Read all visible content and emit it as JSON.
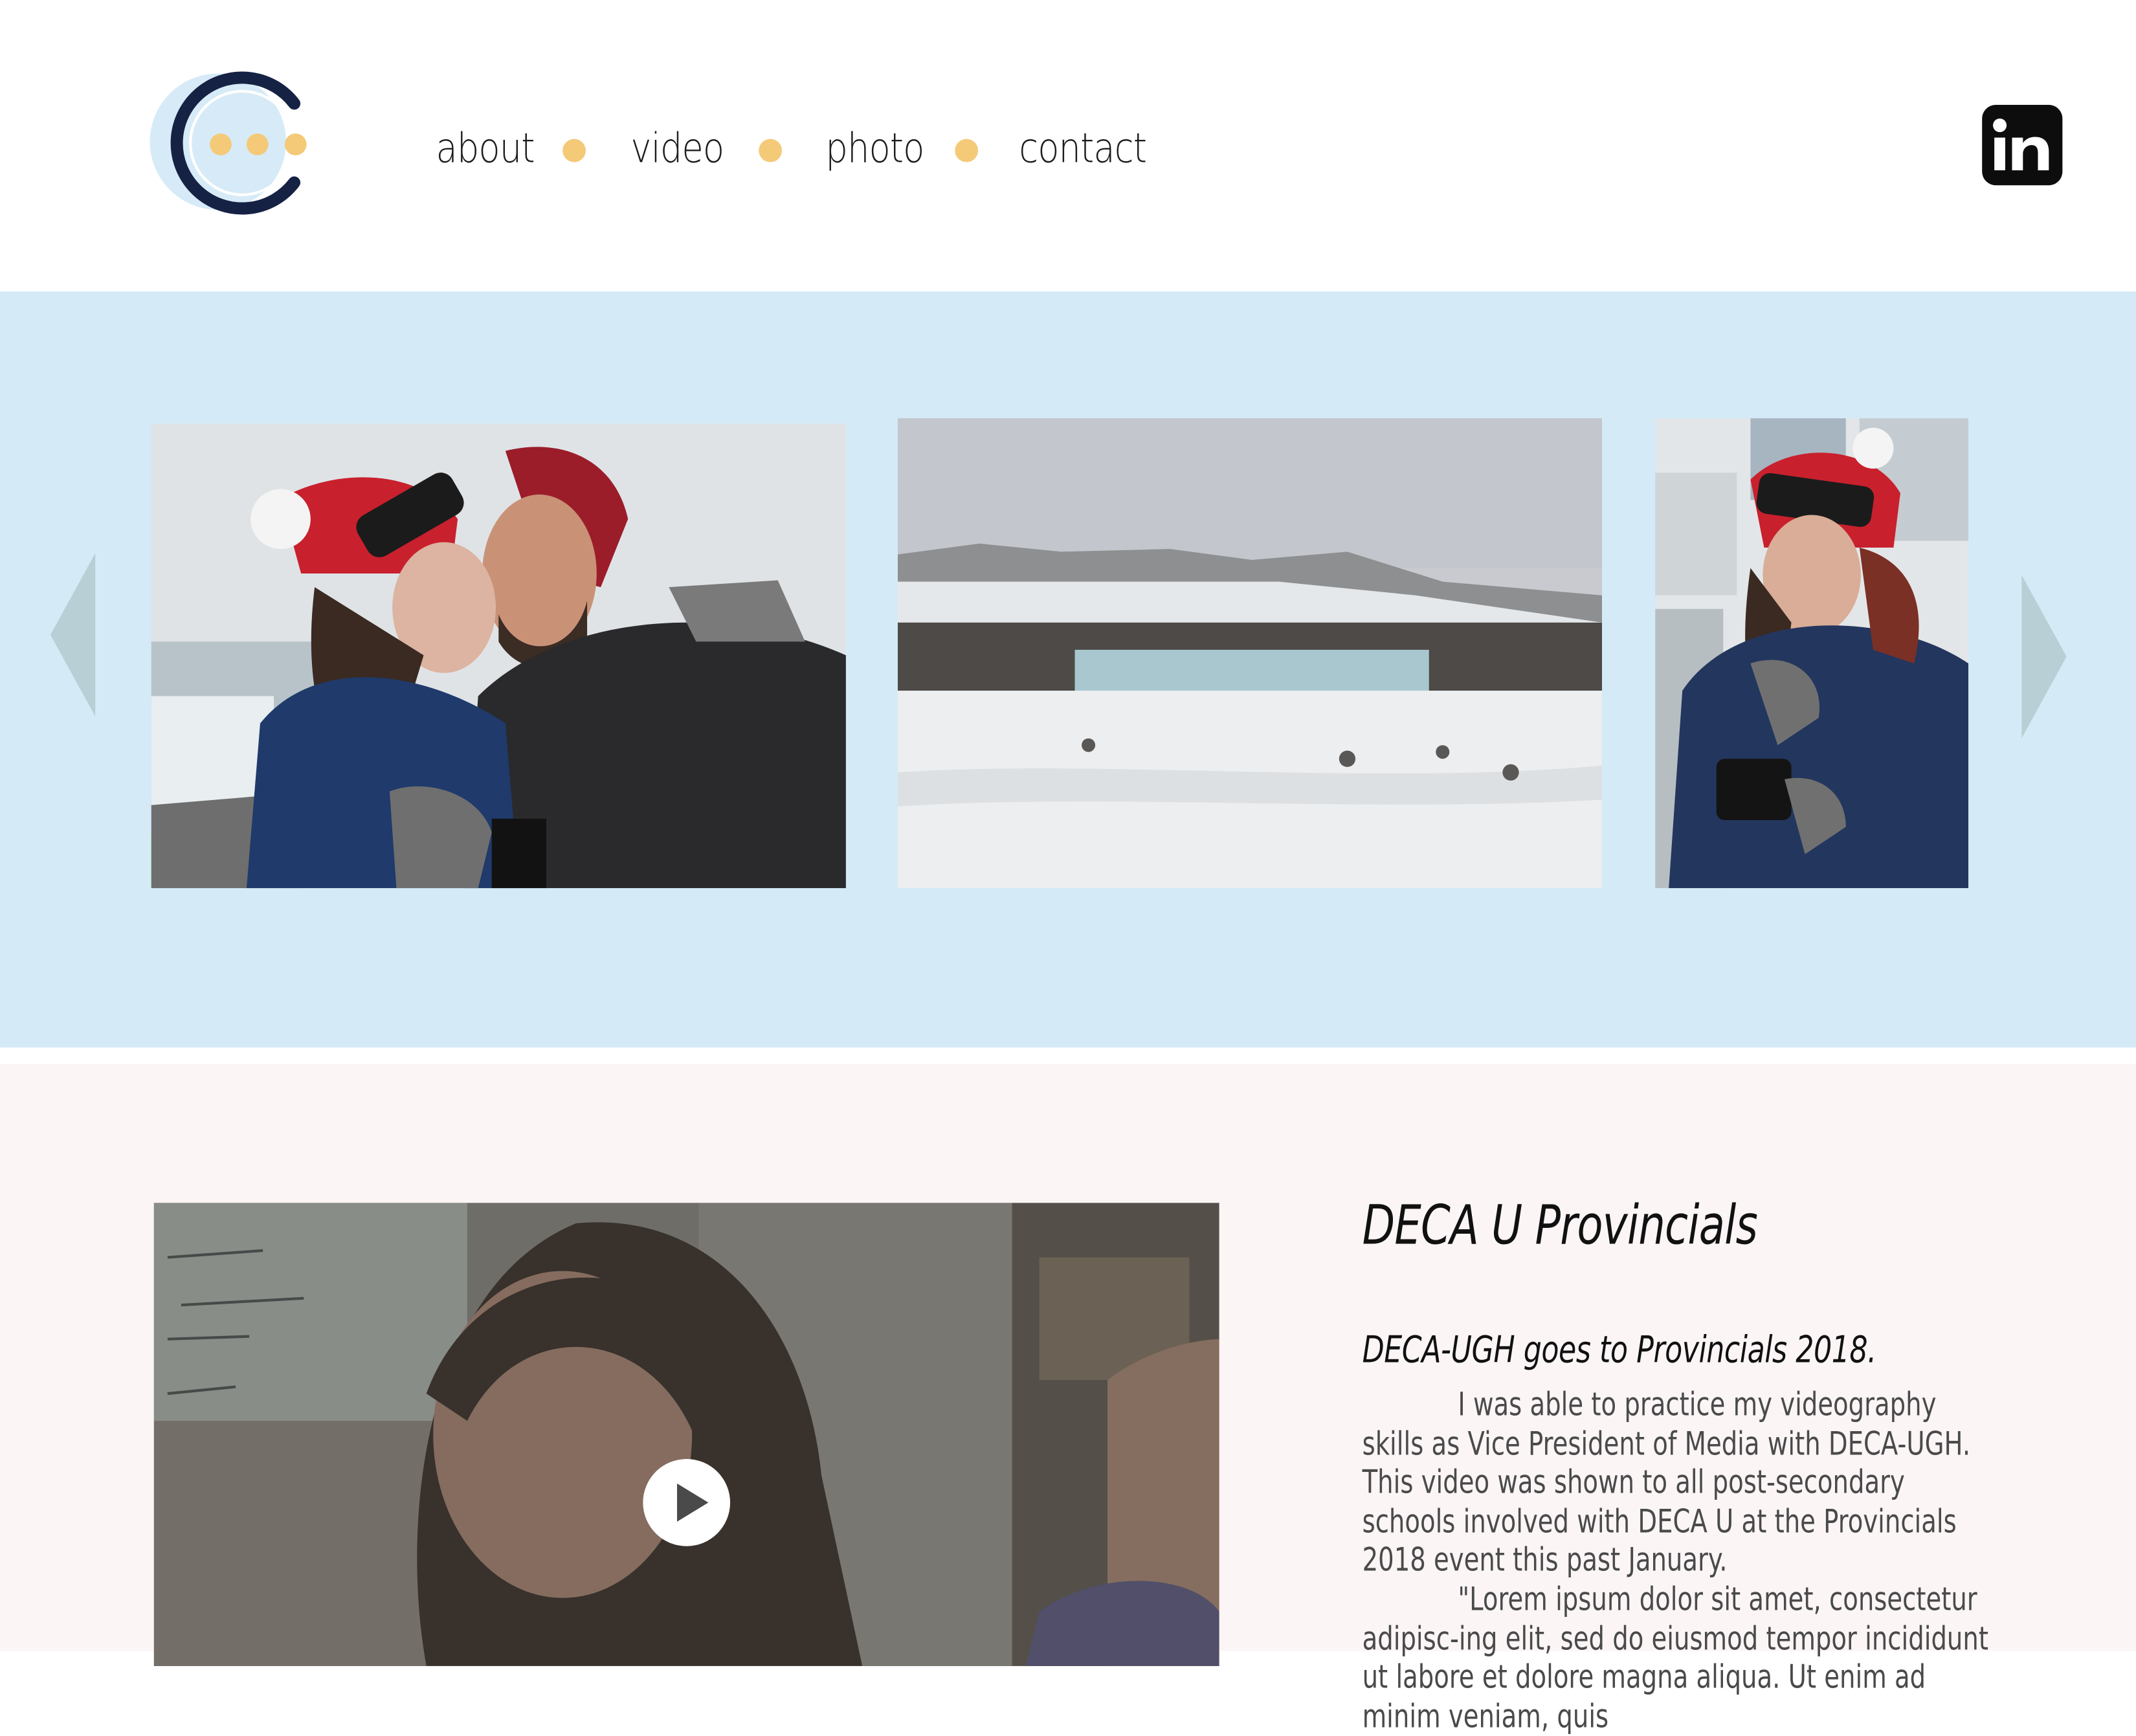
{
  "nav": {
    "items": [
      "about",
      "video",
      "photo",
      "contact"
    ]
  },
  "social": {
    "linkedin_label": "in",
    "linkedin_icon": "linkedin-icon"
  },
  "gallery": {
    "prev_icon": "chevron-left-icon",
    "next_icon": "chevron-right-icon",
    "photos": [
      "couple-kissing-photo",
      "frozen-falls-photo",
      "laughing-photographer-photo"
    ]
  },
  "project": {
    "title": "DECA U Provincials",
    "subtitle": "DECA-UGH goes to Provincials 2018.",
    "paragraph_1": "I was able to practice my videography skills as Vice President of Media with DECA-UGH. This video was shown to all post-secondary schools involved with DECA U at the Provincials 2018 event this past January.",
    "paragraph_2": "\"Lorem ipsum dolor sit amet, consectetur adipisc-ing elit, sed do eiusmod tempor incididunt ut labore et dolore magna aliqua. Ut enim ad minim veniam, quis"
  },
  "colors": {
    "accent_dot": "#f4c978",
    "gallery_bg": "#d4eaf6",
    "section_bg": "#fbf5f6",
    "logo_navy": "#152244"
  }
}
